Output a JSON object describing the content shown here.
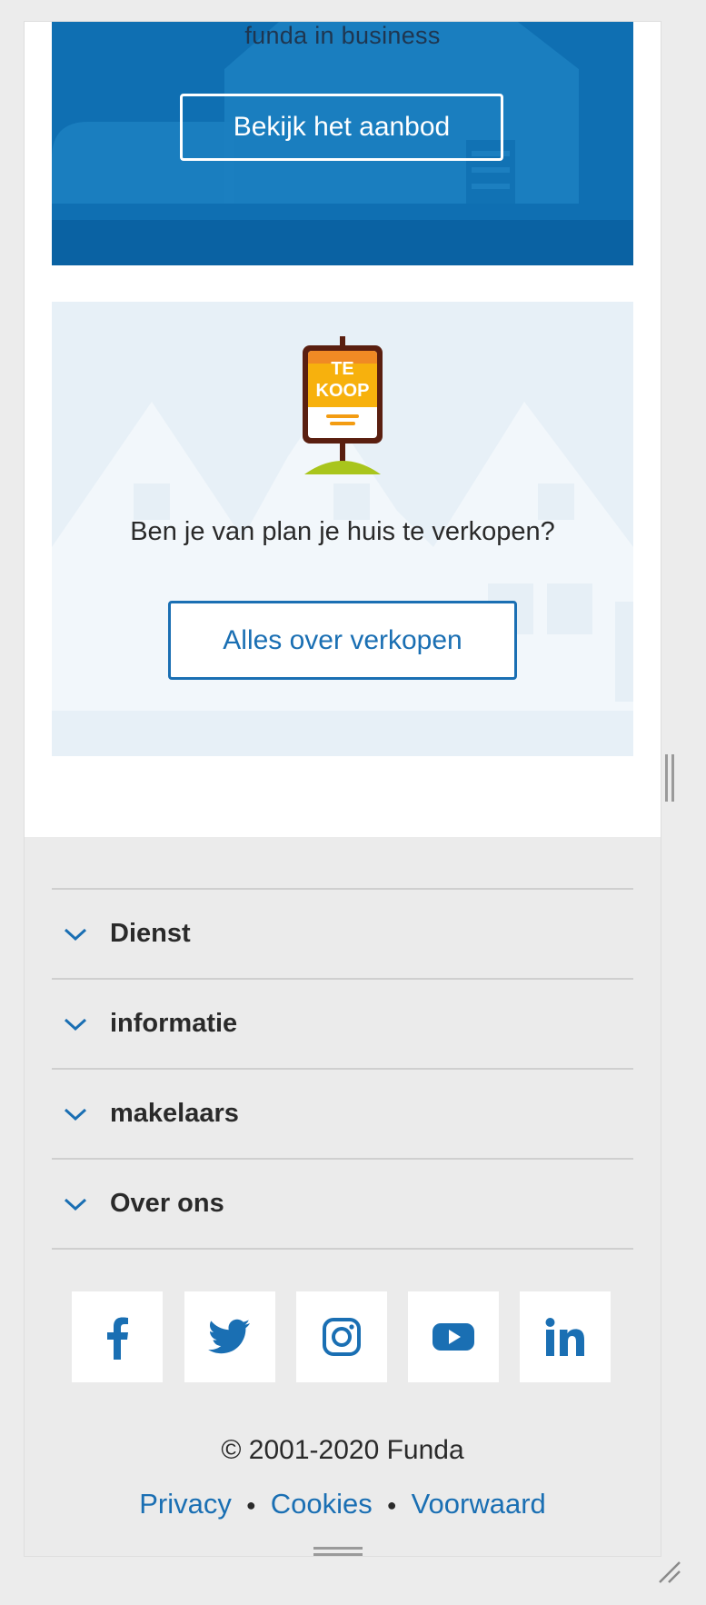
{
  "business_card": {
    "tagline": "funda in business",
    "button_label": "Bekijk het aanbod"
  },
  "sell_card": {
    "sign_text_line1": "TE",
    "sign_text_line2": "KOOP",
    "question": "Ben je van plan je huis te verkopen?",
    "button_label": "Alles over verkopen"
  },
  "footer": {
    "accordion": [
      {
        "label": "Dienst"
      },
      {
        "label": "informatie"
      },
      {
        "label": "makelaars"
      },
      {
        "label": "Over ons"
      }
    ],
    "social": [
      {
        "name": "facebook",
        "icon": "facebook-icon"
      },
      {
        "name": "twitter",
        "icon": "twitter-icon"
      },
      {
        "name": "instagram",
        "icon": "instagram-icon"
      },
      {
        "name": "youtube",
        "icon": "youtube-icon"
      },
      {
        "name": "linkedin",
        "icon": "linkedin-icon"
      }
    ],
    "copyright": "© 2001-2020 Funda",
    "legal_links": [
      "Privacy",
      "Cookies",
      "Voorwaard"
    ]
  },
  "colors": {
    "brand_blue": "#0f6fb2",
    "link_blue": "#1a6fb3",
    "footer_bg": "#ebebeb",
    "sell_card_bg": "#e7f0f7",
    "sign_orange": "#f39c12"
  }
}
